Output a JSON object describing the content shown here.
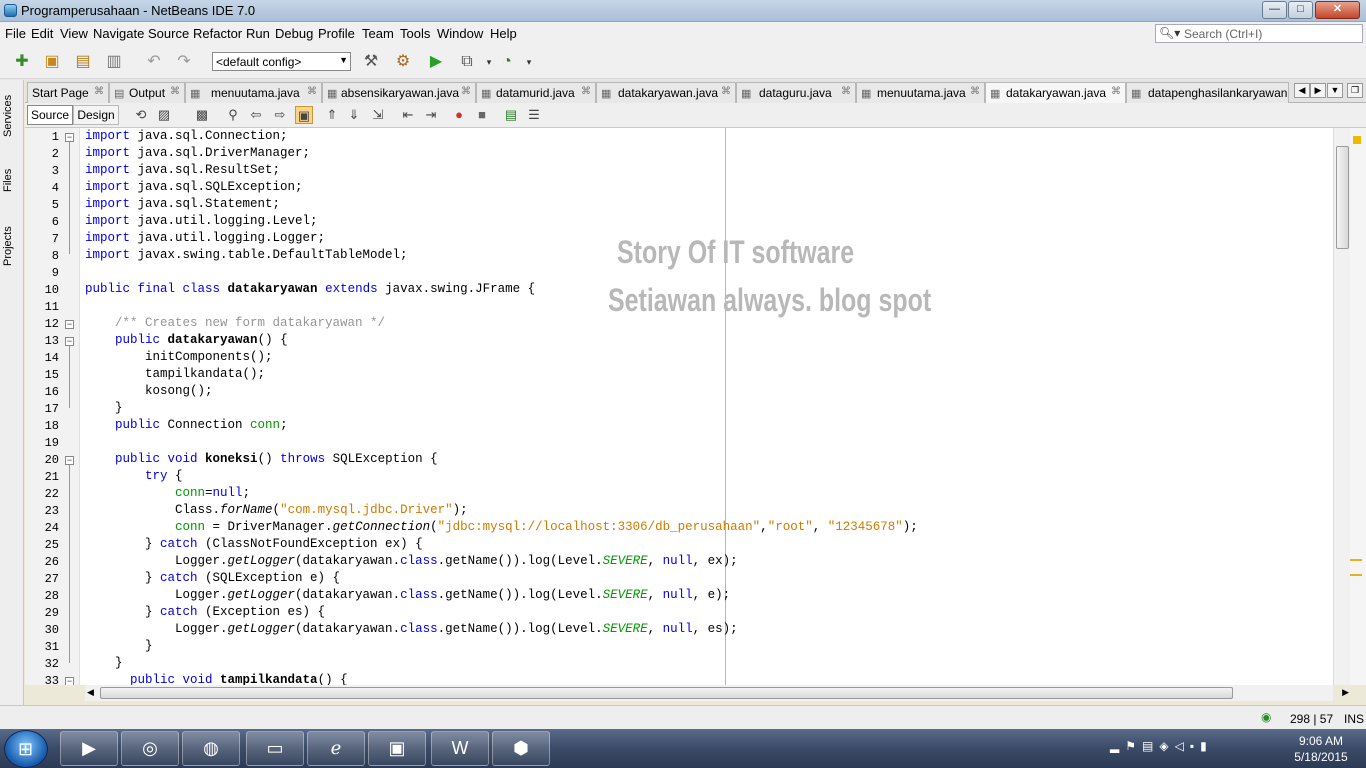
{
  "window": {
    "title": "Programperusahaan - NetBeans IDE 7.0",
    "min_label": "—",
    "max_label": "□",
    "close_label": "✕"
  },
  "menu": [
    "File",
    "Edit",
    "View",
    "Navigate",
    "Source",
    "Refactor",
    "Run",
    "Debug",
    "Profile",
    "Team",
    "Tools",
    "Window",
    "Help"
  ],
  "search": {
    "placeholder": "Search (Ctrl+I)",
    "icon": "search-icon"
  },
  "toolbar": {
    "config_value": "<default config>"
  },
  "side_tabs": [
    "Services",
    "Files",
    "Projects"
  ],
  "editor_tabs": [
    {
      "label": "Start Page"
    },
    {
      "label": "Output"
    },
    {
      "label": "menuutama.java"
    },
    {
      "label": "absensikaryawan.java"
    },
    {
      "label": "datamurid.java"
    },
    {
      "label": "datakaryawan.java"
    },
    {
      "label": "dataguru.java"
    },
    {
      "label": "menuutama.java"
    },
    {
      "label": "datakaryawan.java",
      "active": true
    },
    {
      "label": "datapenghasilankaryawan."
    }
  ],
  "editor_toolbar": {
    "source_label": "Source",
    "design_label": "Design"
  },
  "watermark": {
    "line1": "Story Of IT software",
    "line2": "Setiawan always. blog spot"
  },
  "status": {
    "position": "298 | 57",
    "mode": "INS"
  },
  "clock": {
    "time": "9:06 AM",
    "date": "5/18/2015"
  },
  "colors": {
    "keyword": "#0000e6",
    "string": "#ce7b00",
    "comment": "#969696",
    "field": "#009900",
    "margin": "#e8a0a0"
  }
}
